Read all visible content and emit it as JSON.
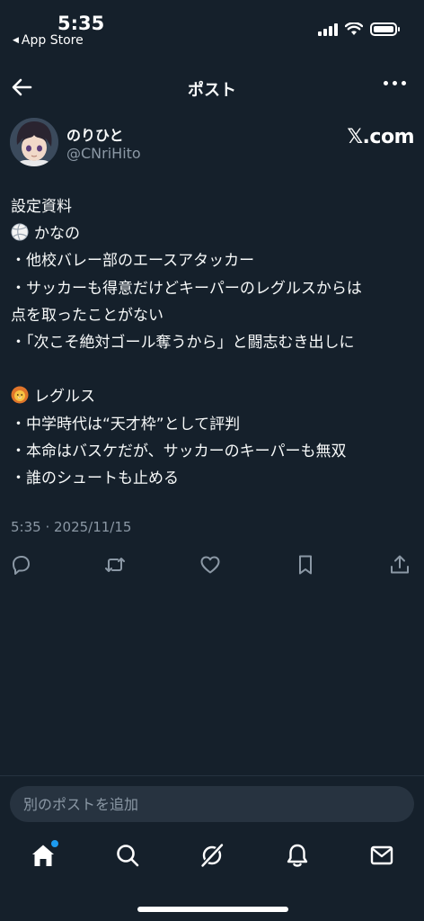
{
  "status_bar": {
    "time": "5:35",
    "back_app": "App Store"
  },
  "header": {
    "title": "ポスト"
  },
  "author": {
    "name": "のりひと",
    "handle": "@CNriHito",
    "brand": "𝕏.com"
  },
  "post": {
    "lines": [
      "設定資料",
      "かなの",
      "・他校バレー部のエースアタッカー",
      "・サッカーも得意だけどキーパーのレグルスからは",
      "点を取ったことがない",
      "・「次こそ絶対ゴール奪うから」と闘志むき出しに",
      "",
      "レグルス",
      "・中学時代は“天才枠”として評判",
      "・本命はバスケだが、サッカーのキーパーも無双",
      "・誰のシュートも止める"
    ],
    "emoji_line1": "volleyball-emoji",
    "emoji_line7": "lion-emoji",
    "timestamp": "5:35 · 2025/11/15"
  },
  "compose": {
    "placeholder": "別のポストを追加"
  },
  "icons": {
    "reply": "reply-icon",
    "repost": "repost-icon",
    "like": "heart-icon",
    "bookmark": "bookmark-icon",
    "share": "share-icon",
    "home": "home-icon",
    "search": "search-icon",
    "grok": "grok-icon",
    "notifications": "bell-icon",
    "messages": "mail-icon"
  },
  "colors": {
    "background": "#15202b",
    "text": "#f7f9f9",
    "secondary_text": "#8b98a5",
    "accent": "#1d9bf0"
  }
}
